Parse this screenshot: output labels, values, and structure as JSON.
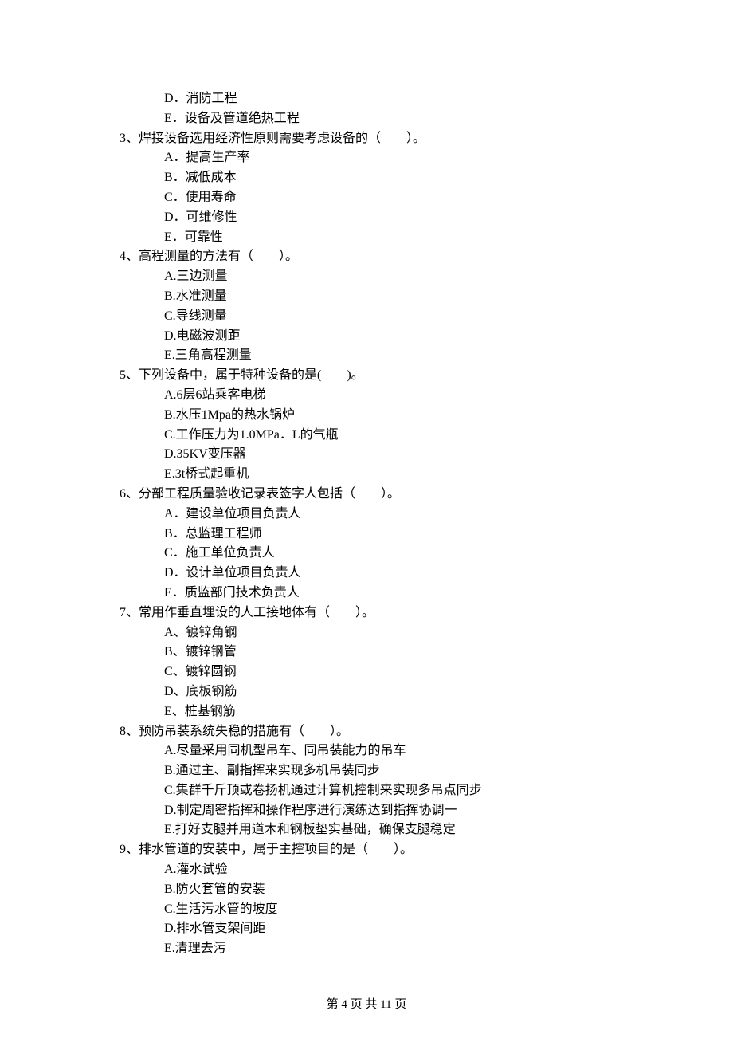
{
  "orphan_options": [
    "D．消防工程",
    "E．设备及管道绝热工程"
  ],
  "questions": [
    {
      "stem": "3、焊接设备选用经济性原则需要考虑设备的（　　）。",
      "options": [
        "A．提高生产率",
        "B．减低成本",
        "C．使用寿命",
        "D．可维修性",
        "E．可靠性"
      ]
    },
    {
      "stem": "4、高程测量的方法有（　　）。",
      "options": [
        "A.三边测量",
        "B.水准测量",
        "C.导线测量",
        "D.电磁波测距",
        "E.三角高程测量"
      ]
    },
    {
      "stem": "5、下列设备中，属于特种设备的是(　　)。",
      "options": [
        "A.6层6站乘客电梯",
        "B.水压1Mpa的热水锅炉",
        "C.工作压力为1.0MPa．L的气瓶",
        "D.35KV变压器",
        "E.3t桥式起重机"
      ]
    },
    {
      "stem": "6、分部工程质量验收记录表签字人包括（　　）。",
      "options": [
        "A．建设单位项目负责人",
        "B．总监理工程师",
        "C．施工单位负责人",
        "D．设计单位项目负责人",
        "E．质监部门技术负责人"
      ]
    },
    {
      "stem": "7、常用作垂直埋设的人工接地体有（　　）。",
      "options": [
        "A、镀锌角钢",
        "B、镀锌钢管",
        "C、镀锌圆钢",
        "D、底板钢筋",
        "E、桩基钢筋"
      ]
    },
    {
      "stem": "8、预防吊装系统失稳的措施有（　　）。",
      "options": [
        "A.尽量采用同机型吊车、同吊装能力的吊车",
        "B.通过主、副指挥来实现多机吊装同步",
        "C.集群千斤顶或卷扬机通过计算机控制来实现多吊点同步",
        "D.制定周密指挥和操作程序进行演练达到指挥协调一",
        "E.打好支腿并用道木和钢板垫实基础，确保支腿稳定"
      ]
    },
    {
      "stem": "9、排水管道的安装中，属于主控项目的是（　　）。",
      "options": [
        "A.灌水试验",
        "B.防火套管的安装",
        "C.生活污水管的坡度",
        "D.排水管支架间距",
        "E.清理去污"
      ]
    }
  ],
  "footer": "第 4 页 共 11 页"
}
